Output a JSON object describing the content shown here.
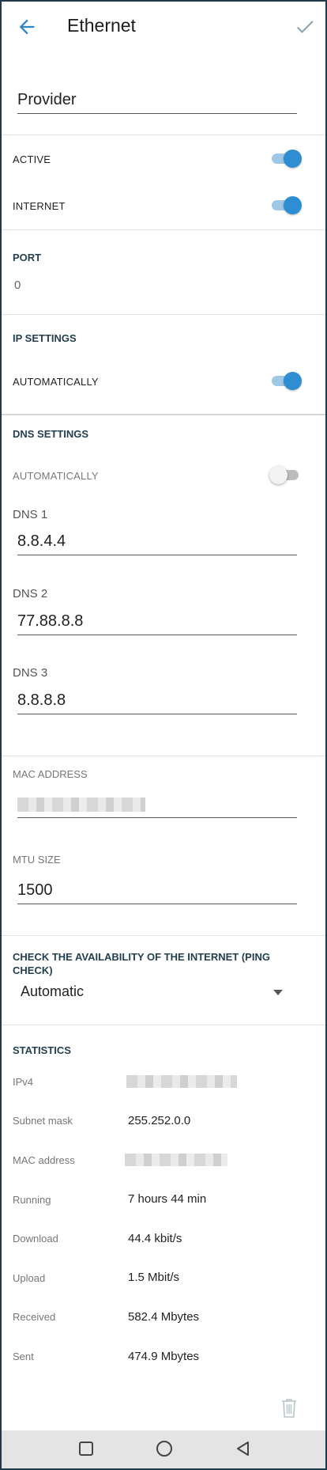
{
  "header": {
    "title": "Ethernet",
    "back_icon": "arrow-left-icon",
    "confirm_icon": "check-icon"
  },
  "name_field": {
    "value": "Provider"
  },
  "active": {
    "label": "ACTIVE",
    "on": true
  },
  "internet": {
    "label": "INTERNET",
    "on": true
  },
  "port": {
    "title": "PORT",
    "value": "0"
  },
  "ip_settings": {
    "title": "IP SETTINGS",
    "auto_label": "AUTOMATICALLY",
    "auto_on": true
  },
  "dns_settings": {
    "title": "DNS SETTINGS",
    "auto_label": "AUTOMATICALLY",
    "auto_on": false,
    "dns1": {
      "label": "DNS 1",
      "value": "8.8.4.4"
    },
    "dns2": {
      "label": "DNS 2",
      "value": "77.88.8.8"
    },
    "dns3": {
      "label": "DNS 3",
      "value": "8.8.8.8"
    }
  },
  "mac": {
    "label": "MAC ADDRESS"
  },
  "mtu": {
    "label": "MTU SIZE",
    "value": "1500"
  },
  "ping_check": {
    "title": "CHECK THE AVAILABILITY OF THE INTERNET (PING CHECK)",
    "selected": "Automatic"
  },
  "statistics": {
    "title": "STATISTICS",
    "rows": [
      {
        "label": "IPv4",
        "value": ""
      },
      {
        "label": "Subnet mask",
        "value": "255.252.0.0"
      },
      {
        "label": "MAC address",
        "value": ""
      },
      {
        "label": "Running",
        "value": "7 hours 44 min"
      },
      {
        "label": "Download",
        "value": "44.4 kbit/s"
      },
      {
        "label": "Upload",
        "value": "1.5 Mbit/s"
      },
      {
        "label": "Received",
        "value": "582.4 Mbytes"
      },
      {
        "label": "Sent",
        "value": "474.9 Mbytes"
      }
    ]
  },
  "colors": {
    "accent": "#2f8ed2",
    "section_title": "#243f4f",
    "nav_bar": "#e4e4e4"
  }
}
